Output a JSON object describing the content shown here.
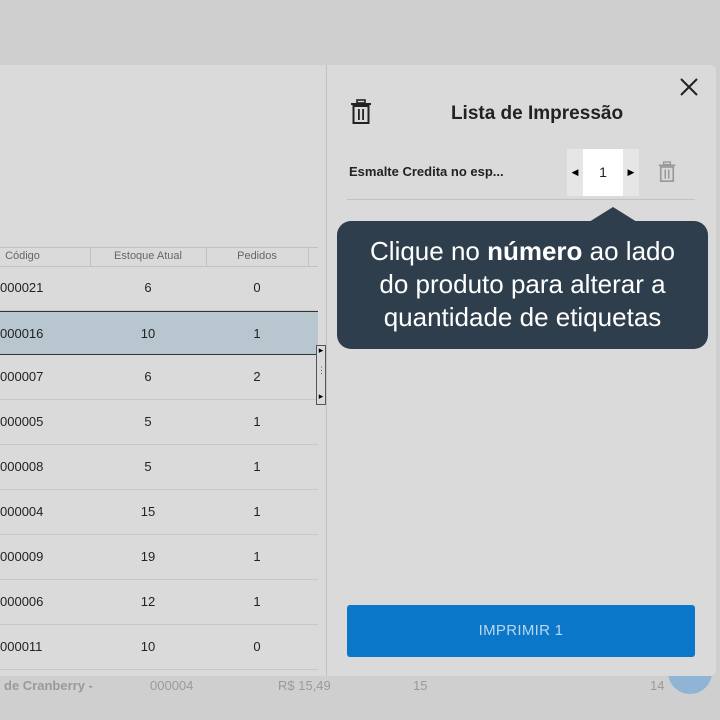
{
  "background": {
    "product_name": "de Cranberry -",
    "code": "000004",
    "price": "R$ 15,49",
    "stock": "15",
    "count": "14"
  },
  "table": {
    "headers": [
      "Código",
      "Estoque Atual",
      "Pedidos"
    ],
    "rows": [
      {
        "code": "000021",
        "stock": "6",
        "orders": "0"
      },
      {
        "code": "000016",
        "stock": "10",
        "orders": "1"
      },
      {
        "code": "000007",
        "stock": "6",
        "orders": "2"
      },
      {
        "code": "000005",
        "stock": "5",
        "orders": "1"
      },
      {
        "code": "000008",
        "stock": "5",
        "orders": "1"
      },
      {
        "code": "000004",
        "stock": "15",
        "orders": "1"
      },
      {
        "code": "000009",
        "stock": "19",
        "orders": "1"
      },
      {
        "code": "000006",
        "stock": "12",
        "orders": "1"
      },
      {
        "code": "000011",
        "stock": "10",
        "orders": "0"
      }
    ],
    "selected_row": 1
  },
  "print_list": {
    "title": "Lista de Impressão",
    "items": [
      {
        "name": "Esmalte Credita no esp...",
        "quantity": "1"
      }
    ],
    "print_button": "IMPRIMIR 1"
  },
  "tooltip": {
    "line1_pre": "Clique no ",
    "line1_bold": "número",
    "line1_post": " ao lado",
    "line2": "do produto para alterar a",
    "line3": "quantidade de etiquetas"
  },
  "colors": {
    "accent": "#0a77c9",
    "tooltip_bg": "#2f3e4c",
    "selected_row": "#b8c6d0"
  }
}
